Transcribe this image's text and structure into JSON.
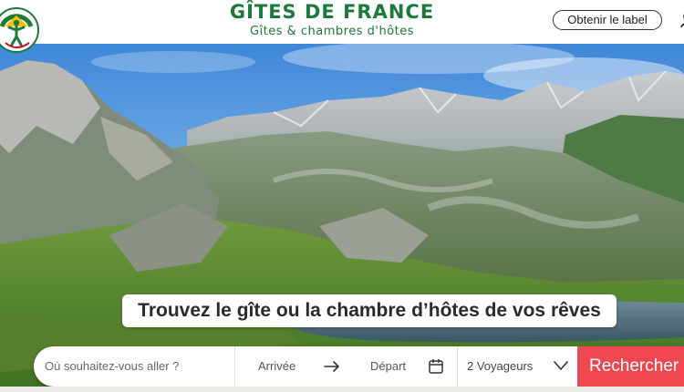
{
  "brand": {
    "title": "GÎTES DE FRANCE",
    "subtitle": "Gîtes & chambres d'hôtes",
    "logo_icon": "gites-de-france-logo",
    "green": "#1d7a3a",
    "yellow": "#f2c400"
  },
  "header": {
    "label_button": "Obtenir le label",
    "edge_icon": "user-icon"
  },
  "hero": {
    "tagline": "Trouvez le gîte ou la chambre d’hôtes de vos rêves",
    "image_icon": "mountain-landscape"
  },
  "search": {
    "destination_placeholder": "Où souhaitez-vous aller ?",
    "arrival_label": "Arrivée",
    "departure_label": "Départ",
    "travelers": "2 Voyageurs",
    "submit_label": "Rechercher",
    "submit_color": "#ef4853",
    "icons": [
      "arrow-right-icon",
      "calendar-icon",
      "chevron-down-icon"
    ]
  }
}
